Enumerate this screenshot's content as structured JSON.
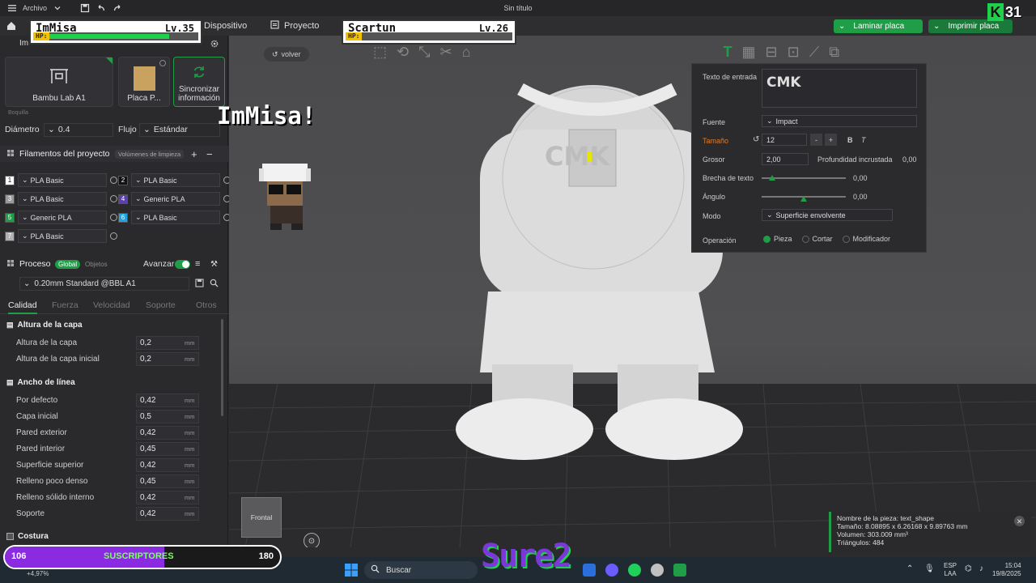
{
  "titlebar": {
    "menu_label": "Archivo",
    "title": "Sin título"
  },
  "topbar": {
    "tabs": [
      "Dispositivo",
      "Proyecto"
    ],
    "slice_button": "Laminar placa",
    "print_button": "Imprimir placa"
  },
  "hud_left": {
    "name": "ImMisa",
    "level": "Lv.35",
    "hp_label": "HP:",
    "hp_fraction": 0.87
  },
  "hud_right": {
    "name": "Scartun",
    "level": "Lv.26",
    "hp_label": "HP:",
    "hp_fraction": 0.0
  },
  "overlay": {
    "shout": "ImMisa!",
    "corner_counter": "31",
    "corner_logo": "K",
    "watermark": "Sure2"
  },
  "left": {
    "tab_partial": "Im",
    "printer_card": "Bambu Lab A1",
    "plate_card": "Placa P...",
    "sync_card_line1": "Sincronizar",
    "sync_card_line2": "información",
    "nozzle_group": "Boquilla",
    "diameter_label": "Diámetro",
    "diameter_value": "0.4",
    "flow_label": "Flujo",
    "flow_value": "Estándar",
    "filaments_title": "Filamentos del proyecto",
    "purge_volumes": "Volúmenes de limpieza",
    "filaments": [
      {
        "num": "1",
        "name": "PLA Basic",
        "color": "#ffffff"
      },
      {
        "num": "2",
        "name": "PLA Basic",
        "color": "#111111"
      },
      {
        "num": "3",
        "name": "PLA Basic",
        "color": "#9a9a9a"
      },
      {
        "num": "4",
        "name": "Generic PLA",
        "color": "#5a3fb0"
      },
      {
        "num": "5",
        "name": "Generic PLA",
        "color": "#1f9d47"
      },
      {
        "num": "6",
        "name": "PLA Basic",
        "color": "#22a3e0"
      },
      {
        "num": "7",
        "name": "PLA Basic",
        "color": "#b0b0b0"
      }
    ],
    "process_title": "Proceso",
    "process_global": "Global",
    "process_objects": "Objetos",
    "advanced_label": "Avanzar",
    "profile": "0.20mm Standard @BBL A1",
    "quality_tabs": [
      "Calidad",
      "Fuerza",
      "Velocidad",
      "Soporte",
      "Otros"
    ],
    "layer_group": "Altura de la capa",
    "layer_params": [
      {
        "label": "Altura de la capa",
        "value": "0,2",
        "unit": "mm"
      },
      {
        "label": "Altura de la capa inicial",
        "value": "0,2",
        "unit": "mm"
      }
    ],
    "width_group": "Ancho de línea",
    "width_params": [
      {
        "label": "Por defecto",
        "value": "0,42",
        "unit": "mm"
      },
      {
        "label": "Capa inicial",
        "value": "0,5",
        "unit": "mm"
      },
      {
        "label": "Pared exterior",
        "value": "0,42",
        "unit": "mm"
      },
      {
        "label": "Pared interior",
        "value": "0,45",
        "unit": "mm"
      },
      {
        "label": "Superficie superior",
        "value": "0,42",
        "unit": "mm"
      },
      {
        "label": "Relleno poco denso",
        "value": "0,45",
        "unit": "mm"
      },
      {
        "label": "Relleno sólido interno",
        "value": "0,42",
        "unit": "mm"
      },
      {
        "label": "Soporte",
        "value": "0,42",
        "unit": "mm"
      }
    ],
    "seam_group": "Costura"
  },
  "viewport": {
    "back_label": "volver",
    "view_cube_label": "Frontal",
    "model_text": "CMK"
  },
  "props": {
    "input_label": "Texto de entrada",
    "input_value": "CMK",
    "font_label": "Fuente",
    "font_value": "Impact",
    "size_label": "Tamaño",
    "size_value": "12",
    "size_minus": "-",
    "size_plus": "+",
    "bold": "B",
    "italic": "T",
    "thickness_label": "Grosor",
    "thickness_value": "2,00",
    "depth_label": "Profundidad incrustada",
    "depth_value": "0,00",
    "gap_label": "Brecha de texto",
    "gap_value": "0,00",
    "angle_label": "Ángulo",
    "angle_value": "0,00",
    "mode_label": "Modo",
    "mode_value": "Superficie envolvente",
    "operation_label": "Operación",
    "operation_options": [
      "Pieza",
      "Cortar",
      "Modificador"
    ],
    "operation_selected": "Pieza"
  },
  "info_box": {
    "line1": "Nombre de la pieza: text_shape",
    "line2": "Tamaño: 8.08895 x 6.26168 x 9.89763 mm",
    "line3": "Volumen: 303.009 mm³",
    "line4": "Triángulos: 484"
  },
  "subs_bar": {
    "min": "106",
    "label": "SUSCRIPTORES",
    "max": "180",
    "fill_fraction": 0.58,
    "growth": "+4,97%"
  },
  "taskbar": {
    "search_placeholder": "Buscar",
    "lang1": "ESP",
    "lang2": "LAA",
    "time": "15:04",
    "date": "19/8/2025"
  },
  "colors": {
    "accent": "#1f9d47",
    "warning": "#e07b2a",
    "purple": "#8a2be2"
  }
}
